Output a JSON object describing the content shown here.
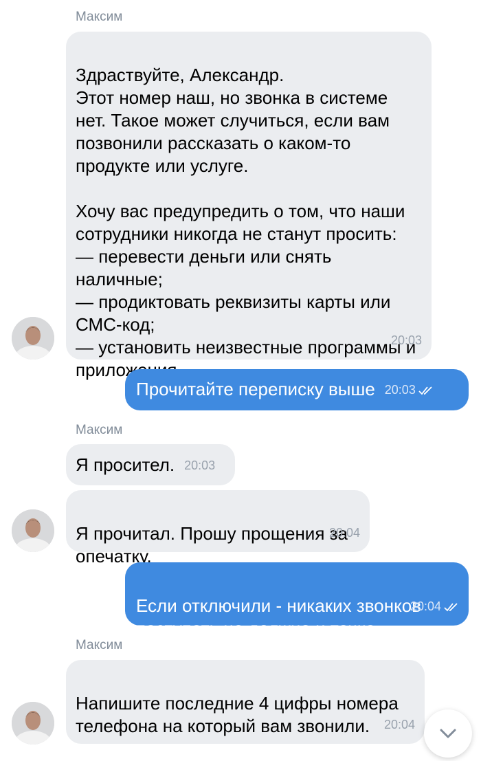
{
  "messages": [
    {
      "sender": "Максим",
      "text": "Здраствуйте, Александр.\nЭтот номер наш, но звонка в системе нет. Такое может случиться, если вам позвонили рассказать о каком-то продукте или услуге.\n\nХочу вас предупредить о том, что наши сотрудники никогда не станут просить:\n— перевести деньги или снять наличные;\n— продиктовать реквизиты карты или СМС-код;\n— установить неизвестные программы и приложения.",
      "time": "20:03"
    },
    {
      "text": "Прочитайте переписку выше",
      "time": "20:03"
    },
    {
      "sender": "Максим",
      "text": "Я просител.",
      "time": "20:03"
    },
    {
      "text": "Я прочитал. Прошу прощения за опечатку.",
      "time": "20:04"
    },
    {
      "text": "Если отключили - никаких звонков поступать не должно и точка",
      "time": "20:04"
    },
    {
      "sender": "Максим",
      "text": "Напишите последние 4 цифры номера телефона на который вам звонили.",
      "time": "20:04"
    }
  ],
  "colors": {
    "incoming_bubble": "#ebedf0",
    "outgoing_bubble": "#3f8ae0",
    "sender_name": "#818c99",
    "timestamp": "#99a2ad"
  },
  "icons": {
    "read_receipt": "double-check-icon",
    "scroll_down": "chevron-down-icon",
    "avatar": "user-avatar"
  }
}
